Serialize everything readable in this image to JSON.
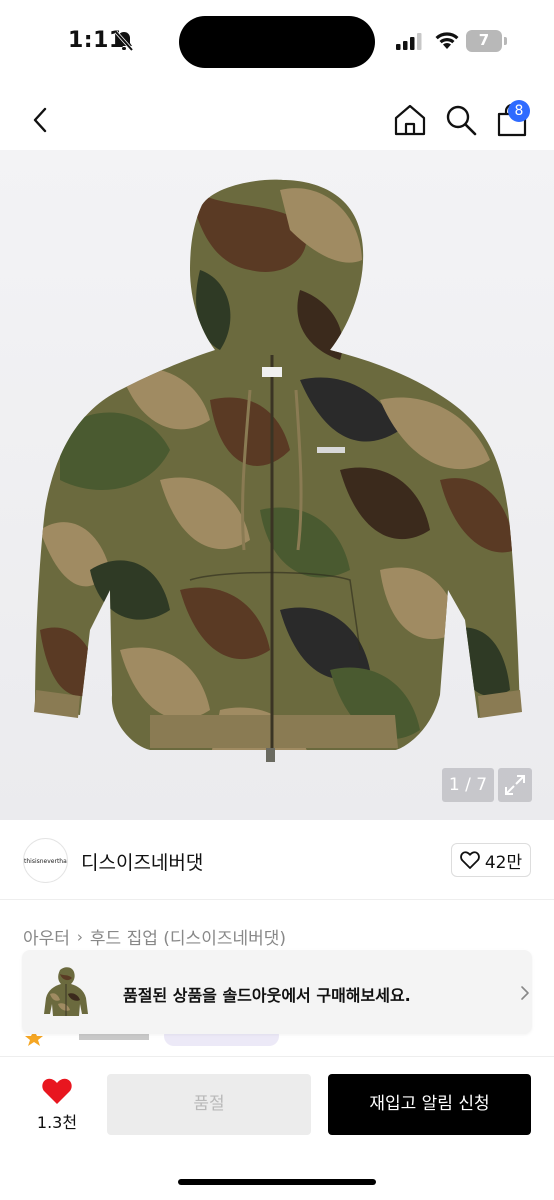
{
  "status_bar": {
    "time": "1:11",
    "battery": "7"
  },
  "nav": {
    "cart_badge": "8"
  },
  "gallery": {
    "page_indicator": "1 / 7"
  },
  "brand": {
    "logo_text": "thisisneverthat",
    "name": "디스이즈네버댓",
    "like_count": "42만"
  },
  "breadcrumb": {
    "items": [
      "아우터",
      "후드 집업 (디스이즈네버댓)"
    ]
  },
  "soldout_banner": {
    "text": "품절된 상품을 솔드아웃에서 구매해보세요."
  },
  "bottom_bar": {
    "wish_count": "1.3천",
    "soldout_label": "품절",
    "restock_label": "재입고 알림 신청"
  },
  "colors": {
    "badge": "#2f6bff",
    "heart": "#e8161f",
    "primary_button": "#000000"
  }
}
